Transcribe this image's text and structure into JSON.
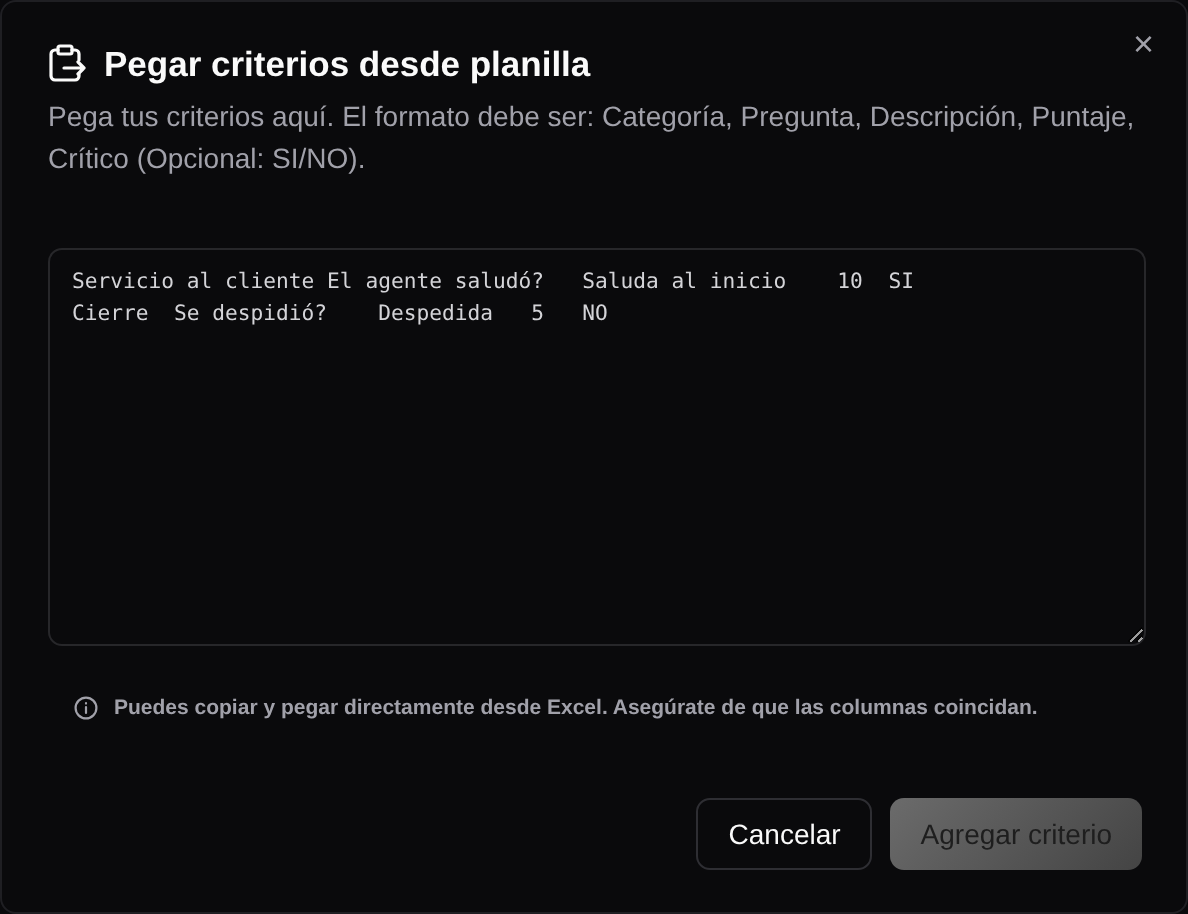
{
  "dialog": {
    "title": "Pegar criterios desde planilla",
    "description": "Pega tus criterios aquí. El formato debe ser: Categoría, Pregunta, Descripción, Puntaje, Crítico (Opcional: SI/NO).",
    "close_label": "×",
    "textarea": {
      "lines": [
        "Servicio al cliente El agente saludó?   Saluda al inicio    10  SI",
        "Cierre  Se despidió?    Despedida   5   NO"
      ]
    },
    "hint": "Puedes copiar y pegar directamente desde Excel. Asegúrate de que las columnas coincidan.",
    "buttons": [
      {
        "label": "Cancelar",
        "kind": "secondary",
        "disabled": false
      },
      {
        "label": "Agregar criterio",
        "kind": "primary",
        "disabled": true
      }
    ]
  }
}
